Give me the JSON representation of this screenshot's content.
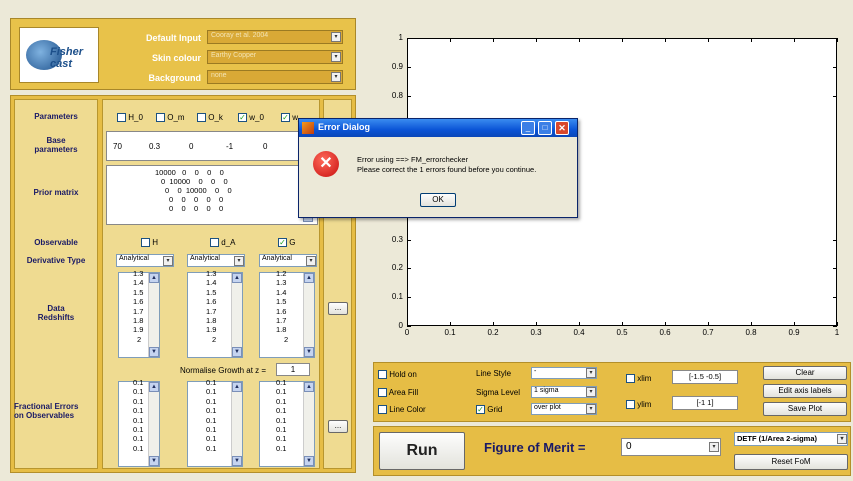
{
  "header": {
    "logo_text": "Fisher cast",
    "default_input_label": "Default Input",
    "default_input_value": "Cooray et al. 2004",
    "skin_colour_label": "Skin colour",
    "skin_colour_value": "Earthy Copper",
    "background_label": "Background",
    "background_value": "none"
  },
  "left": {
    "parameters_label": "Parameters",
    "param_checks": [
      {
        "label": "H_0",
        "checked": false
      },
      {
        "label": "O_m",
        "checked": false
      },
      {
        "label": "O_k",
        "checked": false
      },
      {
        "label": "w_0",
        "checked": true
      },
      {
        "label": "w_",
        "checked": true
      }
    ],
    "base_label": "Base parameters",
    "base_values": [
      "70",
      "0.3",
      "0",
      "-1",
      "0"
    ],
    "prior_label": "Prior matrix",
    "prior_rows": [
      "10000   0    0    0    0",
      "0  10000    0    0    0",
      "0    0  10000    0    0",
      "0    0    0    0    0",
      "0    0    0    0    0"
    ],
    "observable_label": "Observable",
    "observables": [
      {
        "label": "H",
        "checked": false
      },
      {
        "label": "d_A",
        "checked": false
      },
      {
        "label": "G",
        "checked": true
      }
    ],
    "derivative_label": "Derivative Type",
    "derivative_values": [
      "Analytical",
      "Analytical",
      "Analytical"
    ],
    "redshift_label": "Data Redshifts",
    "redshifts": [
      [
        "1.3",
        "1.4",
        "1.5",
        "1.6",
        "1.7",
        "1.8",
        "1.9",
        "2"
      ],
      [
        "1.3",
        "1.4",
        "1.5",
        "1.6",
        "1.7",
        "1.8",
        "1.9",
        "2"
      ],
      [
        "1.2",
        "1.3",
        "1.4",
        "1.5",
        "1.6",
        "1.7",
        "1.8",
        "2"
      ]
    ],
    "normalise_label": "Normalise Growth at z =",
    "normalise_value": "1",
    "errors_label": "Fractional Errors on Observables",
    "errors": [
      [
        "0.1",
        "0.1",
        "0.1",
        "0.1",
        "0.1",
        "0.1",
        "0.1",
        "0.1"
      ],
      [
        "0.1",
        "0.1",
        "0.1",
        "0.1",
        "0.1",
        "0.1",
        "0.1",
        "0.1"
      ],
      [
        "0.1",
        "0.1",
        "0.1",
        "0.1",
        "0.1",
        "0.1",
        "0.1",
        "0.1"
      ]
    ],
    "ellipsis": "..."
  },
  "dialog": {
    "title": "Error Dialog",
    "line1": "Error using ==> FM_errorchecker",
    "line2": "Please correct the 1 errors found before you continue.",
    "ok": "OK"
  },
  "plot": {
    "yticks": [
      "1",
      "0.9",
      "0.8",
      "0.3",
      "0.2",
      "0.1",
      "0"
    ],
    "xticks": [
      "0",
      "0.1",
      "0.2",
      "0.3",
      "0.4",
      "0.5",
      "0.6",
      "0.7",
      "0.8",
      "0.9",
      "1"
    ]
  },
  "controls": {
    "hold_on": "Hold on",
    "area_fill": "Area Fill",
    "line_color": "Line Color",
    "line_style_label": "Line Style",
    "line_style_value": "-",
    "sigma_label": "Sigma Level",
    "sigma_value": "1 sigma",
    "grid_label": "Grid",
    "grid_value": "over plot",
    "xlim_label": "xlim",
    "xlim_value": "[-1.5 -0.5]",
    "ylim_label": "ylim",
    "ylim_value": "[-1 1]",
    "clear": "Clear",
    "edit_axis": "Edit axis labels",
    "save_plot": "Save Plot"
  },
  "run": {
    "run_label": "Run",
    "fom_label": "Figure of Merit =",
    "fom_value": "0",
    "fom_type": "DETF (1/Area 2-sigma)",
    "reset": "Reset FoM"
  }
}
